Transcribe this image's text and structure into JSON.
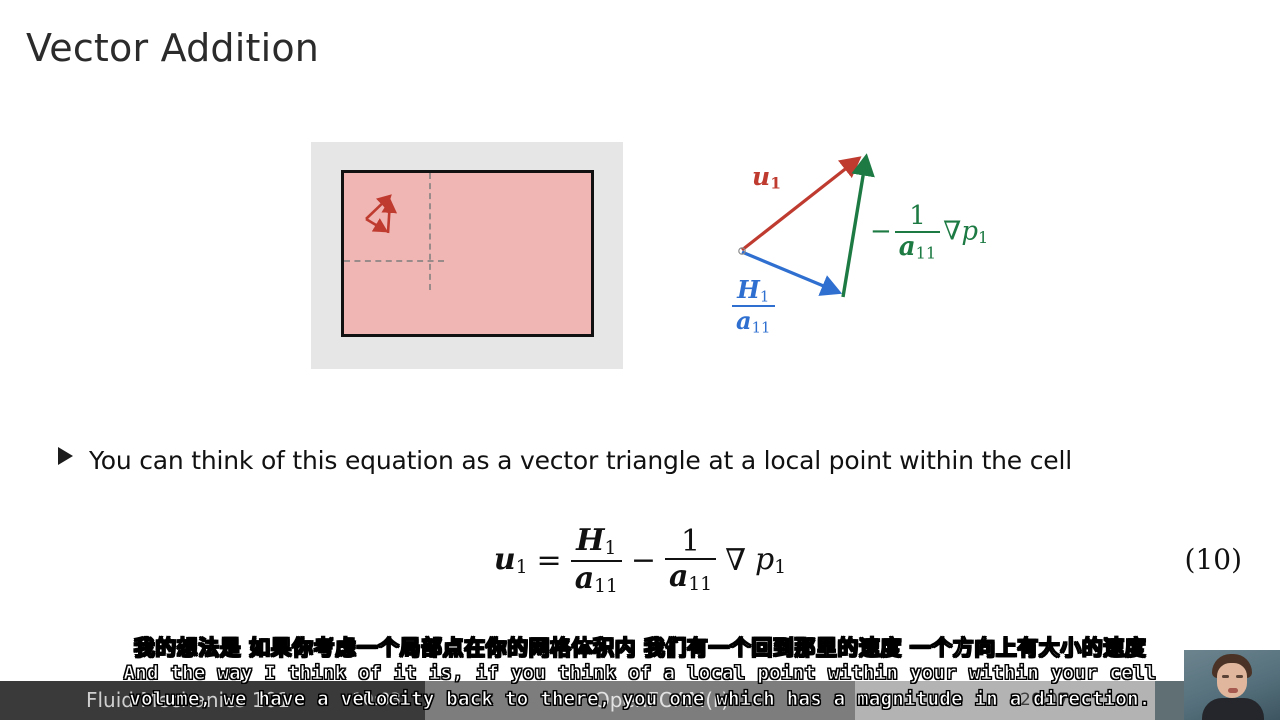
{
  "slide": {
    "title": "Vector Addition",
    "bullet": {
      "marker": "triangle-bullet",
      "text": "You can think of this equation as a vector triangle at a local point within the cell"
    },
    "equation": {
      "lhs_var": "u",
      "lhs_sub": "1",
      "equals": "=",
      "term1_num_var": "H",
      "term1_num_sub": "1",
      "term1_den_var": "a",
      "term1_den_sub": "11",
      "minus": "−",
      "term2_num": "1",
      "term2_den_var": "a",
      "term2_den_sub": "11",
      "nabla": "∇",
      "rhs_var": "p",
      "rhs_sub": "1",
      "number": "(10)"
    }
  },
  "cell_figure": {
    "name": "grid-cell-diagram",
    "background_color": "#e6e6e6",
    "cell_fill_color": "#f0b6b4",
    "cell_border_color": "#111111",
    "dashed_line_color": "#9a8b8b",
    "vector_color": "#bf3b30"
  },
  "triangle_figure": {
    "name": "vector-triangle-diagram",
    "vectors": [
      {
        "label": "u1",
        "color": "#bf3b30",
        "meaning": "velocity-vector"
      },
      {
        "label": "H1/a11",
        "color": "#2f6fd0",
        "meaning": "h-operator-vector"
      },
      {
        "label": "-1/a11 grad p1",
        "color": "#1d7a43",
        "meaning": "pressure-gradient-vector"
      }
    ],
    "label_u": {
      "var": "u",
      "sub": "1"
    },
    "label_h": {
      "num_var": "H",
      "num_sub": "1",
      "den_var": "a",
      "den_sub": "11"
    },
    "label_grad": {
      "minus": "−",
      "num": "1",
      "den_var": "a",
      "den_sub": "11",
      "nabla": "∇",
      "var": "p",
      "sub": "1"
    }
  },
  "subtitles": {
    "chinese": "我的想法是 如果你考虑一个局部点在你的网格体积内 我们有一个回到那里的速度 一个方向上有大小的速度",
    "english_line_1": "And the way I think of it is, if you think of a local point within your within your cell",
    "english_line_2": "volume, we have a velocity back to there, you one which has a magnitude in a direction."
  },
  "player": {
    "title": "Fluid Mechanics 101",
    "channel": "OpenFOAM(r)",
    "time_elapsed": "10:03",
    "time_total": "20:07",
    "band_colors": [
      "#3a3a3a",
      "#7d7d7d",
      "#b3b3b3",
      "#5f6f73"
    ]
  },
  "webcam": {
    "name": "presenter-webcam",
    "description": "presenter"
  }
}
